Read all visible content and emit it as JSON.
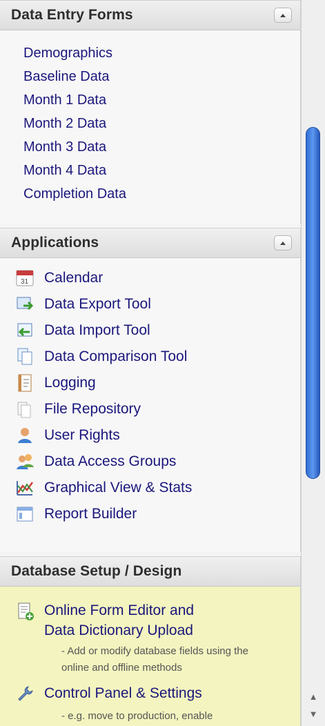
{
  "sections": {
    "data_entry_forms": {
      "title": "Data Entry Forms",
      "items": [
        "Demographics",
        "Baseline Data",
        "Month 1 Data",
        "Month 2 Data",
        "Month 3 Data",
        "Month 4 Data",
        "Completion Data"
      ]
    },
    "applications": {
      "title": "Applications",
      "items": [
        {
          "label": "Calendar",
          "icon": "calendar-icon"
        },
        {
          "label": "Data Export Tool",
          "icon": "data-export-icon"
        },
        {
          "label": "Data Import Tool",
          "icon": "data-import-icon"
        },
        {
          "label": "Data Comparison Tool",
          "icon": "data-comparison-icon"
        },
        {
          "label": "Logging",
          "icon": "logging-icon"
        },
        {
          "label": "File Repository",
          "icon": "file-repository-icon"
        },
        {
          "label": "User Rights",
          "icon": "user-rights-icon"
        },
        {
          "label": "Data Access Groups",
          "icon": "data-access-groups-icon"
        },
        {
          "label": "Graphical View & Stats",
          "icon": "graphical-view-stats-icon"
        },
        {
          "label": "Report Builder",
          "icon": "report-builder-icon"
        }
      ]
    },
    "database_setup": {
      "title": "Database Setup / Design",
      "items": [
        {
          "title_line1": "Online Form Editor and",
          "title_line2": "Data Dictionary Upload",
          "description_line1": "- Add or modify database fields using the",
          "description_line2": "online and offline methods",
          "icon": "form-editor-icon"
        },
        {
          "title_line1": "Control Panel & Settings",
          "description_line1": "- e.g. move to production, enable",
          "icon": "wrench-icon"
        }
      ]
    }
  },
  "scrollbar": {
    "up_arrow": "▲",
    "down_arrow": "▼"
  },
  "colors": {
    "link": "#1b177c",
    "header_text": "#2d2d2d",
    "setup_background": "#f3f4bf",
    "scroll_thumb": "#3a79dc"
  }
}
